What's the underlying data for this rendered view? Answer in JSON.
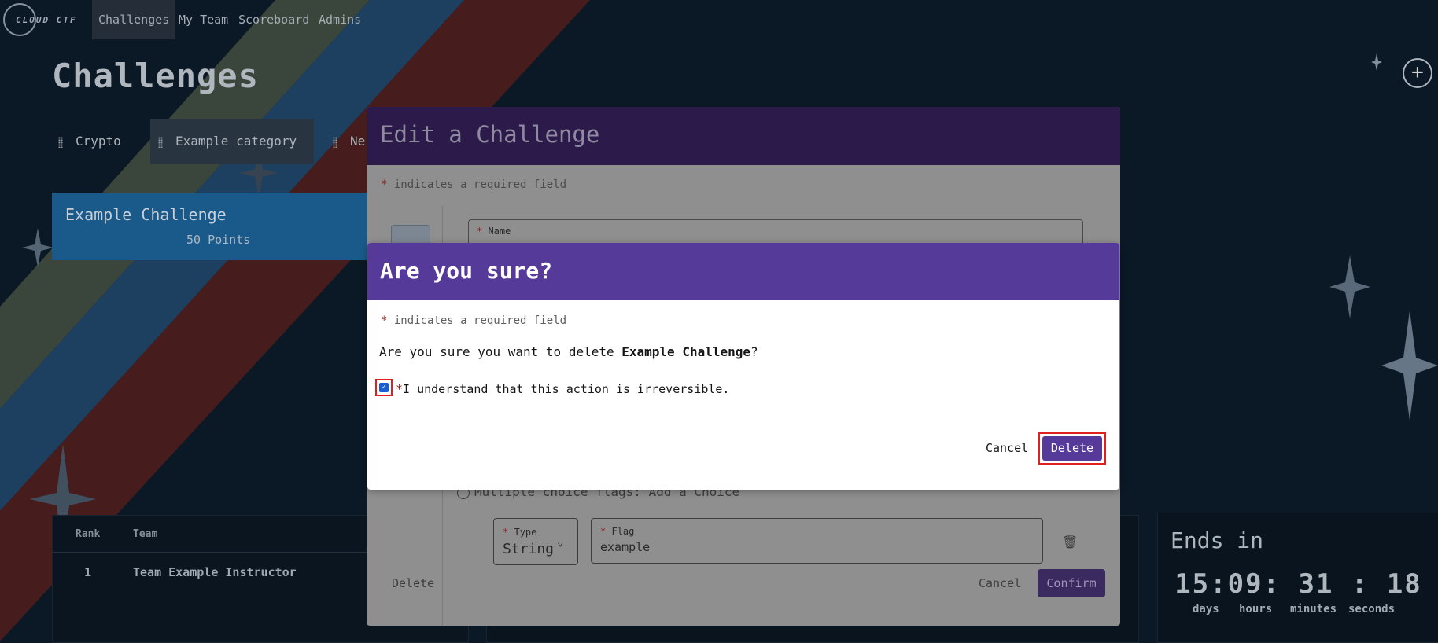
{
  "nav": {
    "logo_text": "CLOUD CTF",
    "items": [
      "Challenges",
      "My Team",
      "Scoreboard",
      "Admins"
    ],
    "active": "Challenges"
  },
  "page": {
    "title": "Challenges",
    "add_icon": "plus-icon"
  },
  "categories": [
    "Crypto",
    "Example category",
    "Ne"
  ],
  "challenge_card": {
    "name": "Example Challenge",
    "points": "50 Points"
  },
  "scoreboard": {
    "headers": [
      "Rank",
      "Team"
    ],
    "rows": [
      {
        "rank": "1",
        "team": "Team Example Instructor"
      }
    ]
  },
  "ends": {
    "title": "Ends in",
    "time": "15:09: 31 : 18",
    "labels": [
      "days",
      "hours",
      "minutes",
      "seconds"
    ]
  },
  "edit_modal": {
    "title": "Edit a Challenge",
    "required_note": "indicates a required field",
    "name_label": "Name",
    "multiple_choice": "Multiple choice flags: Add a Choice",
    "type_label": "Type",
    "type_value": "String",
    "flag_label": "Flag",
    "flag_value": "example",
    "delete_label": "Delete",
    "cancel_label": "Cancel",
    "confirm_label": "Confirm"
  },
  "confirm_dialog": {
    "title": "Are you sure?",
    "required_note": "indicates a required field",
    "message_prefix": "Are you sure you want to delete ",
    "message_target": "Example Challenge",
    "message_suffix": "?",
    "checkbox_label": "I understand that this action is irreversible.",
    "checkbox_checked": true,
    "cancel_label": "Cancel",
    "delete_label": "Delete"
  },
  "colors": {
    "background": "#0c1a28",
    "accent_purple": "#553a9a",
    "highlight_red": "#e0201f",
    "card_blue": "#1c5f92"
  }
}
